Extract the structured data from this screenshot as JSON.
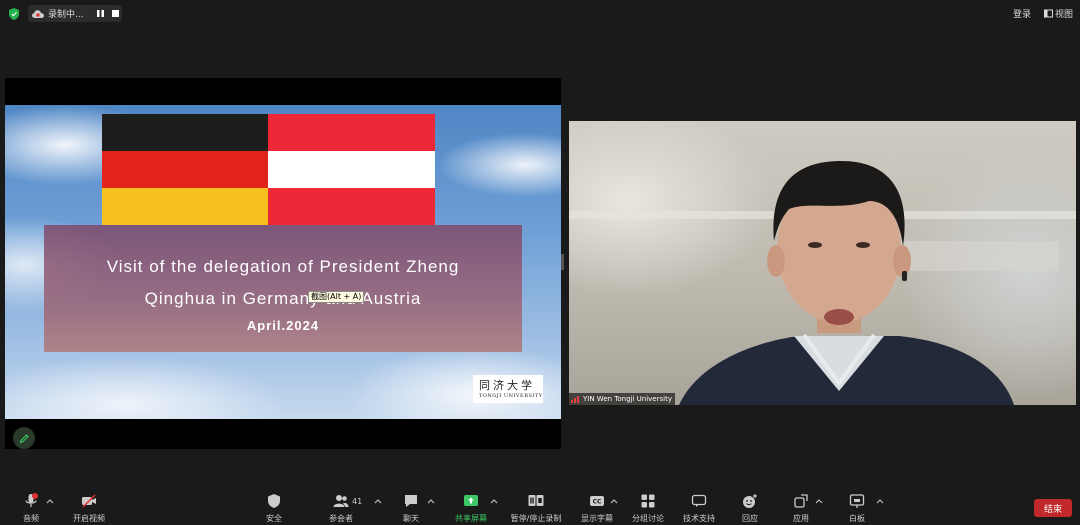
{
  "top_bar": {
    "recording_label": "录制中...",
    "login_label": "登录",
    "view_label": "视图"
  },
  "share": {
    "slide_title_line1": "Visit of the delegation of President Zheng",
    "slide_title_line2": "Qinghua in Germany and Austria",
    "slide_date": "April.2024",
    "tooltip": "截图(Alt + A)",
    "logo_cn": "同济大学",
    "logo_en": "TONGJI UNIVERSITY",
    "flags": {
      "germany": [
        "#1d1d1b",
        "#e2231a",
        "#f6c11e"
      ],
      "austria": [
        "#ed2939",
        "#ffffff",
        "#ed2939"
      ]
    }
  },
  "video": {
    "participant_name": "YIN Wen Tongji University"
  },
  "toolbar": {
    "mic_label": "音频",
    "video_label": "开启视频",
    "security_label": "安全",
    "participants_label": "参会者",
    "participants_count": "41",
    "chat_label": "聊天",
    "share_label": "共享屏幕",
    "record_label": "暂停/停止录制",
    "captions_label": "显示字幕",
    "breakout_label": "分组讨论",
    "support_label": "技术支持",
    "reactions_label": "回应",
    "apps_label": "应用",
    "whiteboard_label": "白板",
    "end_label": "结束",
    "colors": {
      "accent_green": "#3cc864",
      "end_red": "#c0282a"
    }
  }
}
